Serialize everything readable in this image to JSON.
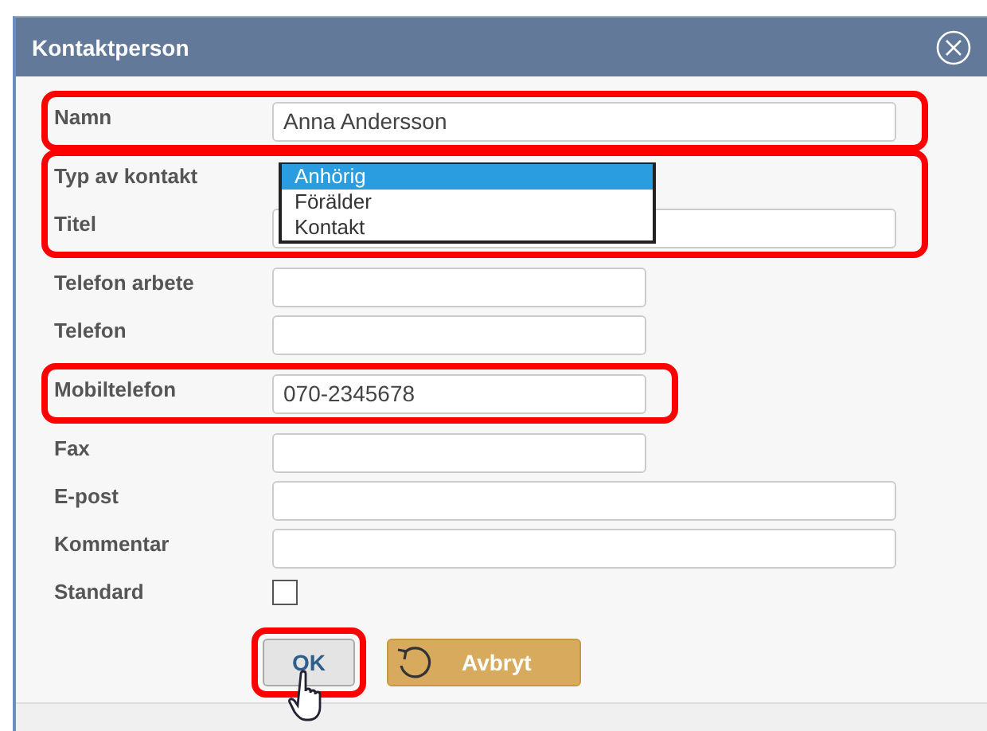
{
  "dialog": {
    "title": "Kontaktperson"
  },
  "groups": [
    {
      "highlighted": true,
      "fields": [
        {
          "label": "Namn",
          "kind": "text",
          "wide": true,
          "value": "Anna Andersson"
        }
      ]
    },
    {
      "highlighted": true,
      "fields": [
        {
          "label": "Typ av kontakt",
          "kind": "listbox",
          "options": [
            {
              "label": "Anhörig",
              "selected": true
            },
            {
              "label": "Förälder",
              "selected": false
            },
            {
              "label": "Kontakt",
              "selected": false
            }
          ]
        },
        {
          "label": "Titel",
          "kind": "text",
          "wide": true
        }
      ]
    },
    {
      "highlighted": false,
      "fields": [
        {
          "label": "Telefon arbete",
          "kind": "text",
          "wide": false
        },
        {
          "label": "Telefon",
          "kind": "text",
          "wide": false
        }
      ]
    },
    {
      "highlighted": true,
      "fields": [
        {
          "label": "Mobiltelefon",
          "kind": "text",
          "wide": false,
          "value": "070-2345678"
        }
      ]
    },
    {
      "highlighted": false,
      "fields": [
        {
          "label": "Fax",
          "kind": "text",
          "wide": false
        },
        {
          "label": "E-post",
          "kind": "text",
          "wide": true
        },
        {
          "label": "Kommentar",
          "kind": "text",
          "wide": true
        },
        {
          "label": "Standard",
          "kind": "checkbox",
          "checked": false
        }
      ]
    }
  ],
  "buttons": [
    {
      "label": "OK",
      "kind": "primary",
      "highlighted": true
    },
    {
      "label": "Avbryt",
      "kind": "cancel",
      "highlighted": false
    }
  ]
}
